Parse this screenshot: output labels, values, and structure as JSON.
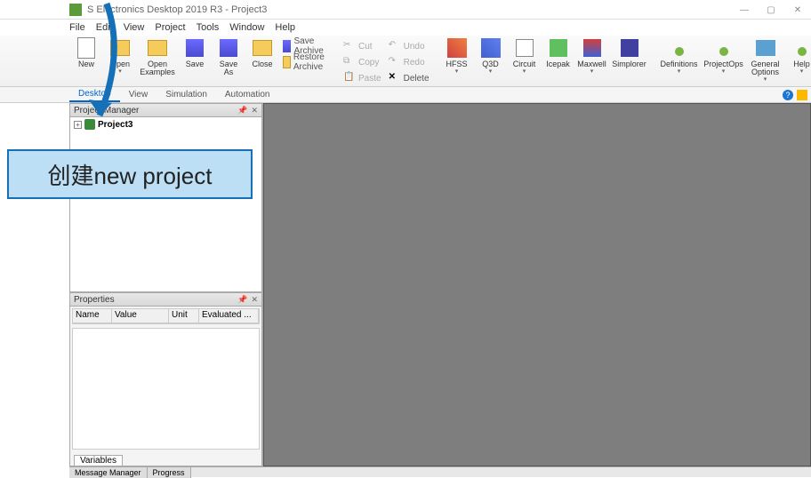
{
  "titlebar": {
    "title": "S Electronics Desktop 2019 R3 - Project3"
  },
  "menu": {
    "items": [
      "File",
      "Edit",
      "View",
      "Project",
      "Tools",
      "Window",
      "Help"
    ]
  },
  "ribbon": {
    "file": [
      {
        "label": "New"
      },
      {
        "label": "Open"
      },
      {
        "label": "Open\nExamples"
      },
      {
        "label": "Save"
      },
      {
        "label": "Save\nAs"
      },
      {
        "label": "Close"
      }
    ],
    "archive": [
      {
        "label": "Save Archive"
      },
      {
        "label": "Restore Archive"
      }
    ],
    "edit": [
      {
        "label": "Cut"
      },
      {
        "label": "Copy"
      },
      {
        "label": "Paste"
      },
      {
        "label": "Undo"
      },
      {
        "label": "Redo"
      },
      {
        "label": "Delete"
      }
    ],
    "products": [
      {
        "label": "HFSS"
      },
      {
        "label": "Q3D"
      },
      {
        "label": "Circuit"
      },
      {
        "label": "Icepak"
      },
      {
        "label": "Maxwell"
      },
      {
        "label": "Simplorer"
      }
    ],
    "right": [
      {
        "label": "Definitions"
      },
      {
        "label": "ProjectOps"
      },
      {
        "label": "General\nOptions"
      },
      {
        "label": "Help"
      }
    ]
  },
  "tabs": {
    "items": [
      "Desktop",
      "View",
      "Simulation",
      "Automation"
    ],
    "active": 0
  },
  "project_manager": {
    "title": "Project Manager",
    "root": "Project3"
  },
  "properties": {
    "title": "Properties",
    "columns": [
      "Name",
      "Value",
      "Unit",
      "Evaluated ..."
    ],
    "tab": "Variables"
  },
  "bottom_tabs": [
    "Message Manager",
    "Progress"
  ],
  "annotation": {
    "text": "创建new project"
  }
}
